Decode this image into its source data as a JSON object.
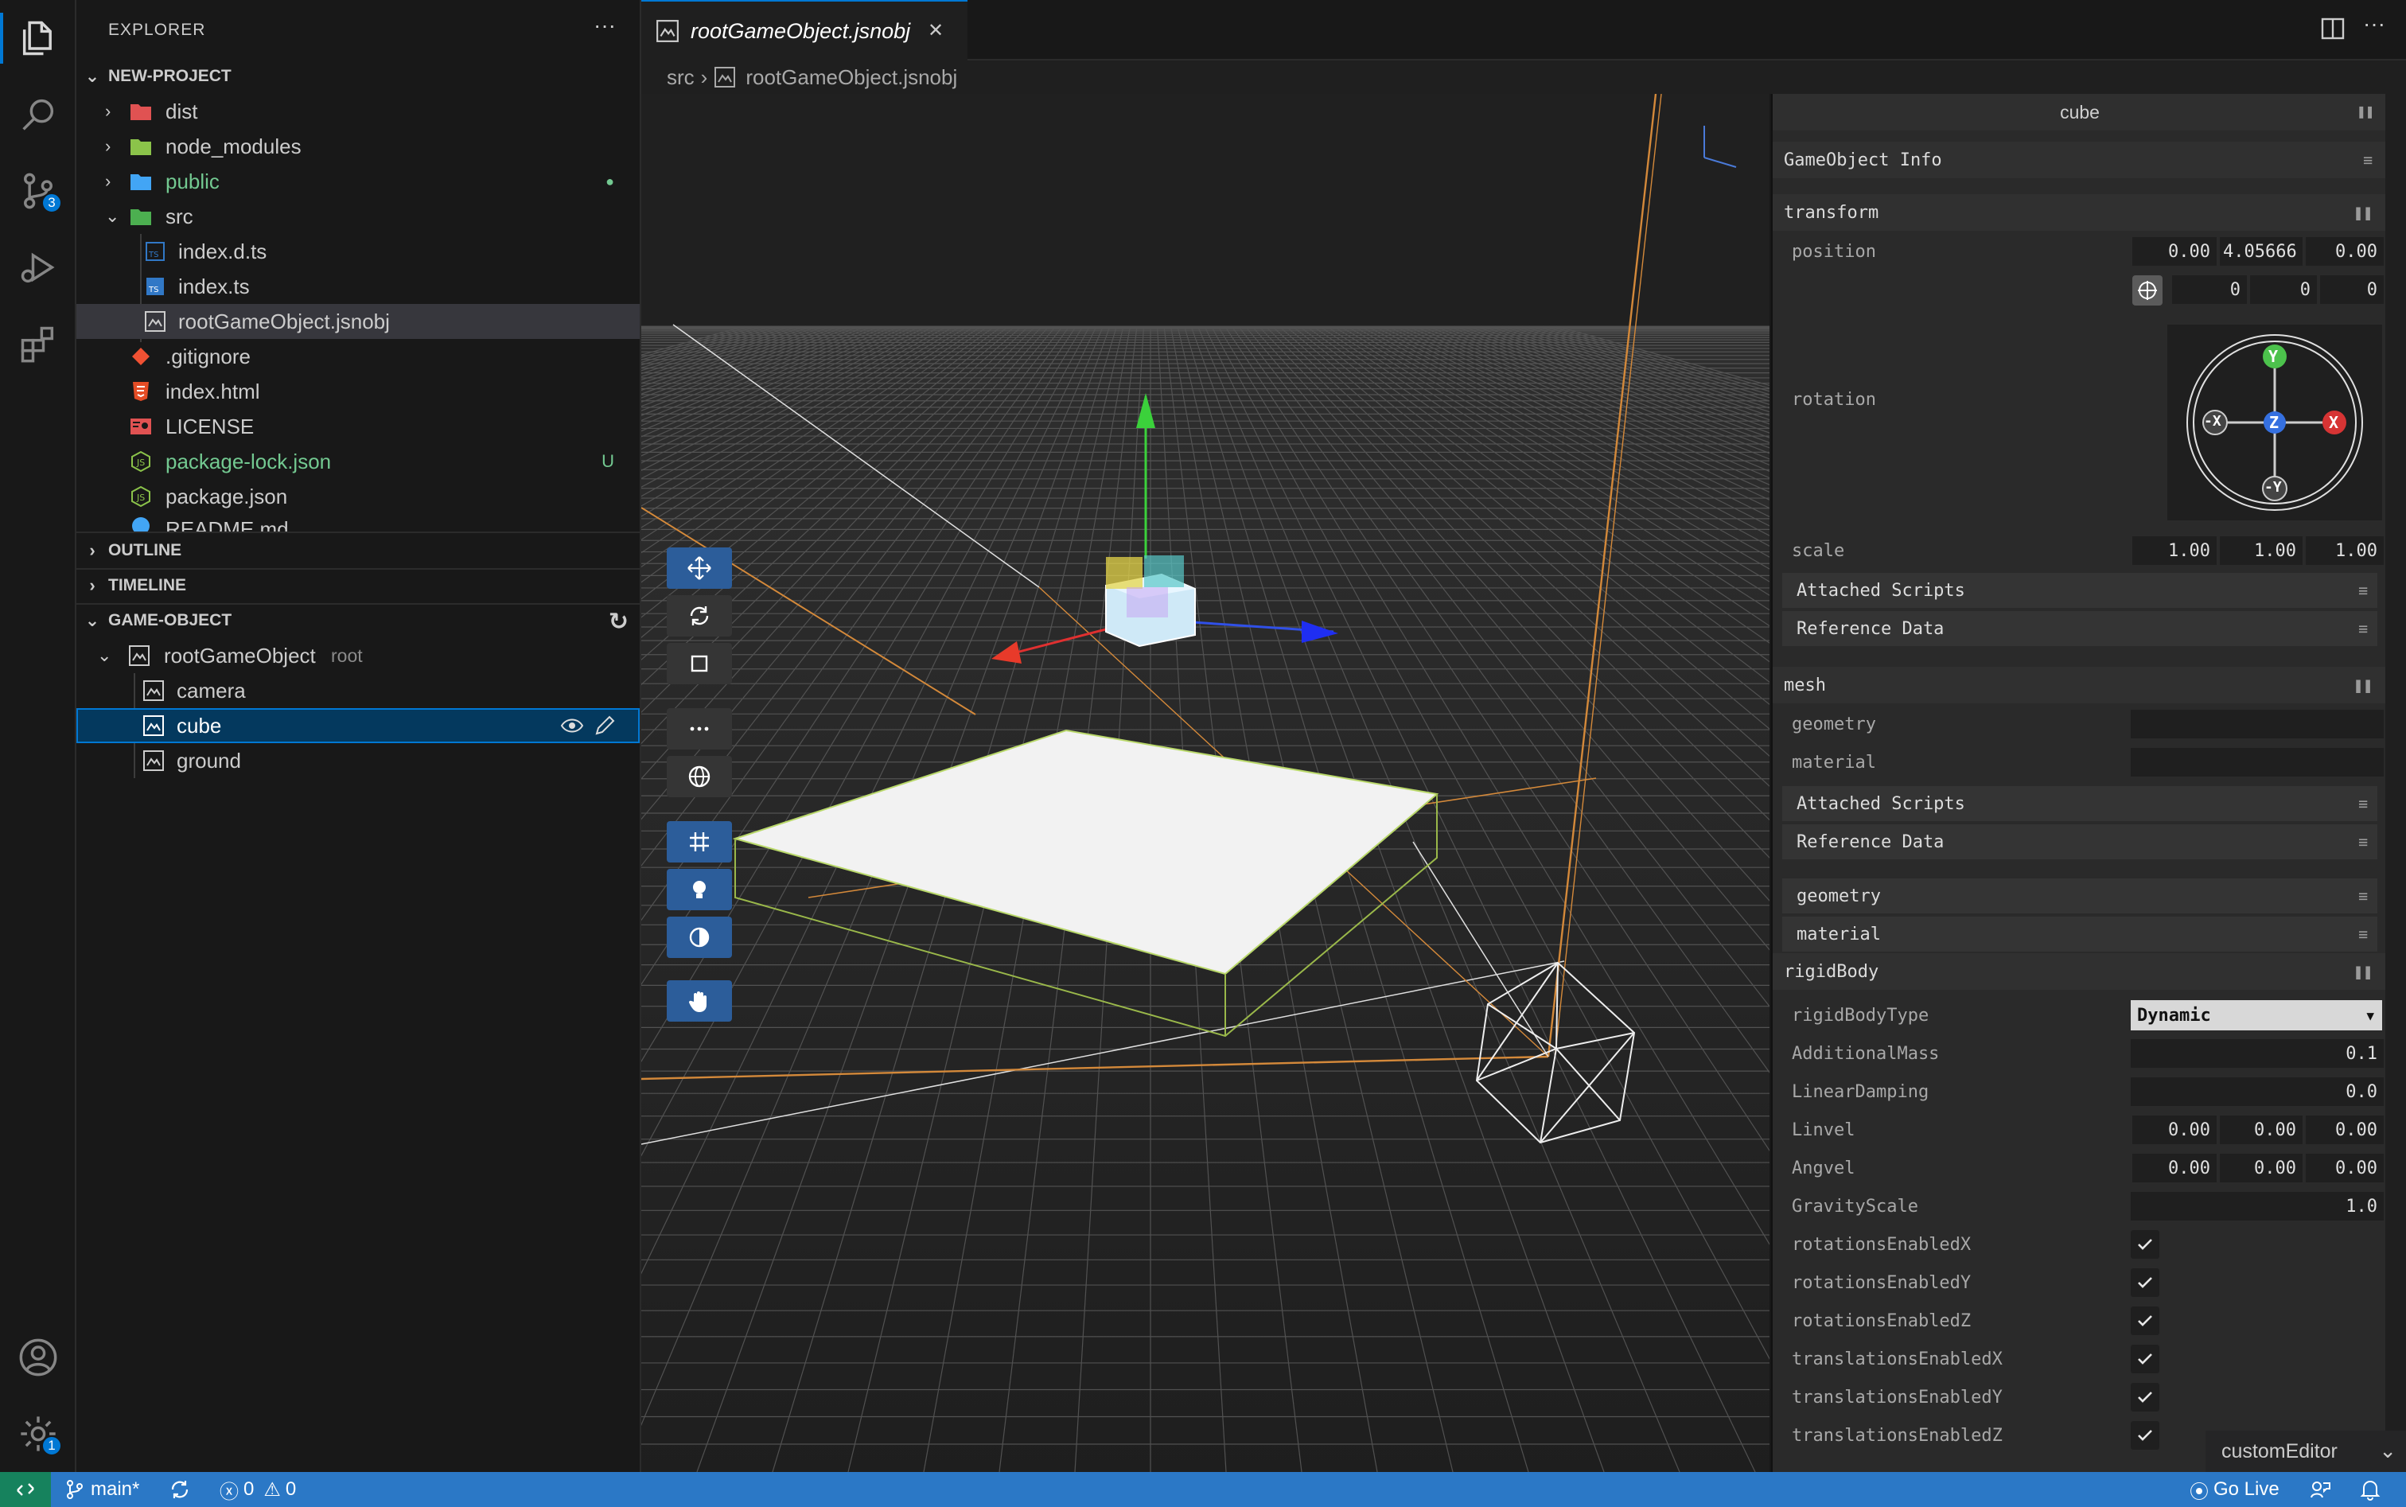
{
  "activity_bar": {
    "items": [
      {
        "name": "explorer-icon"
      },
      {
        "name": "search-icon"
      },
      {
        "name": "source-control-icon",
        "badge": "3"
      },
      {
        "name": "run-debug-icon"
      },
      {
        "name": "extensions-icon"
      }
    ],
    "bottom": [
      {
        "name": "account-icon"
      },
      {
        "name": "manage-gear-icon",
        "badge": "1"
      }
    ]
  },
  "sidebar": {
    "title": "EXPLORER",
    "more": "···",
    "project": {
      "label": "NEW-PROJECT",
      "files": [
        {
          "name": "dist",
          "color": "#cccccc"
        },
        {
          "name": "node_modules",
          "color": "#cccccc"
        },
        {
          "name": "public",
          "color": "#73c991",
          "decoration": "●"
        },
        {
          "name": "src",
          "color": "#cccccc"
        },
        {
          "name": "index.d.ts",
          "color": "#cccccc"
        },
        {
          "name": "index.ts",
          "color": "#cccccc"
        },
        {
          "name": "rootGameObject.jsnobj",
          "color": "#cccccc"
        },
        {
          "name": ".gitignore",
          "color": "#cccccc"
        },
        {
          "name": "index.html",
          "color": "#cccccc"
        },
        {
          "name": "LICENSE",
          "color": "#cccccc"
        },
        {
          "name": "package-lock.json",
          "color": "#73c991",
          "decoration": "U"
        },
        {
          "name": "package.json",
          "color": "#cccccc"
        },
        {
          "name": "README.md",
          "color": "#cccccc"
        }
      ]
    },
    "outline": "OUTLINE",
    "timeline": "TIMELINE",
    "game_object": {
      "label": "GAME-OBJECT",
      "root": "rootGameObject",
      "root_tag": "root",
      "children": [
        "camera",
        "cube",
        "ground"
      ]
    }
  },
  "editor": {
    "tab_title": "rootGameObject.jsnobj",
    "tab_close": "✕",
    "breadcrumb": [
      "src",
      "rootGameObject.jsnobj"
    ]
  },
  "inspector": {
    "title": "cube",
    "gameobject_info": "GameObject Info",
    "transform": {
      "label": "transform",
      "position_label": "position",
      "position": [
        "0.00",
        "4.05666",
        "0.00"
      ],
      "rotation_label": "rotation",
      "rotation": [
        "0",
        "0",
        "0"
      ],
      "gizmo_axes": [
        "Y",
        "-X",
        "Z",
        "X",
        "-Y"
      ],
      "scale_label": "scale",
      "scale": [
        "1.00",
        "1.00",
        "1.00"
      ],
      "attached_scripts": "Attached Scripts",
      "reference_data": "Reference Data"
    },
    "mesh": {
      "label": "mesh",
      "geometry_label": "geometry",
      "material_label": "material",
      "attached_scripts": "Attached Scripts",
      "reference_data": "Reference Data",
      "geometry_folder": "geometry",
      "material_folder": "material"
    },
    "rigidbody": {
      "label": "rigidBody",
      "type_label": "rigidBodyType",
      "type_value": "Dynamic",
      "mass_label": "AdditionalMass",
      "mass": "0.1",
      "lineardamping_label": "LinearDamping",
      "lineardamping": "0.0",
      "linvel_label": "Linvel",
      "linvel": [
        "0.00",
        "0.00",
        "0.00"
      ],
      "angvel_label": "Angvel",
      "angvel": [
        "0.00",
        "0.00",
        "0.00"
      ],
      "gravity_label": "GravityScale",
      "gravity": "1.0",
      "flags": [
        {
          "label": "rotationsEnabledX",
          "checked": true
        },
        {
          "label": "rotationsEnabledY",
          "checked": true
        },
        {
          "label": "rotationsEnabledZ",
          "checked": true
        },
        {
          "label": "translationsEnabledX",
          "checked": true
        },
        {
          "label": "translationsEnabledY",
          "checked": true
        },
        {
          "label": "translationsEnabledZ",
          "checked": true
        }
      ]
    }
  },
  "custom_editor": "customEditor",
  "status_bar": {
    "branch": "main*",
    "errors": "0",
    "warnings": "0",
    "go_live": "Go Live",
    "accent": "#2b78c6"
  }
}
